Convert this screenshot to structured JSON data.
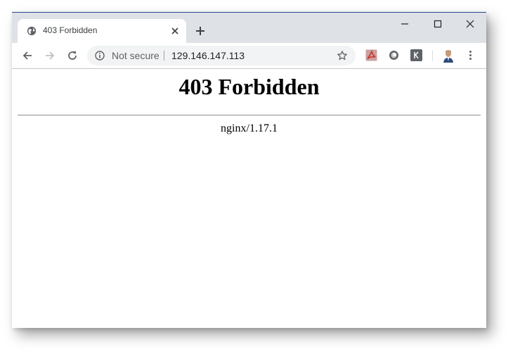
{
  "browser": {
    "tab": {
      "title": "403 Forbidden",
      "favicon": "globe-icon"
    },
    "address_bar": {
      "security_label": "Not secure",
      "url": "129.146.147.113"
    },
    "toolbar_icons": [
      "back-icon",
      "forward-icon",
      "reload-icon",
      "info-icon",
      "star-icon",
      "adobe-acrobat-extension-icon",
      "circle-extension-icon",
      "k-extension-icon",
      "avatar",
      "menu-icon"
    ],
    "window_controls": [
      "minimize-icon",
      "maximize-icon",
      "close-icon"
    ]
  },
  "page": {
    "heading": "403 Forbidden",
    "server_signature": "nginx/1.17.1"
  },
  "colors": {
    "titlebar": "#dee1e6",
    "omnibox": "#f1f3f4",
    "acrobat": "#c9302c",
    "extension_k": "#5f6368"
  }
}
